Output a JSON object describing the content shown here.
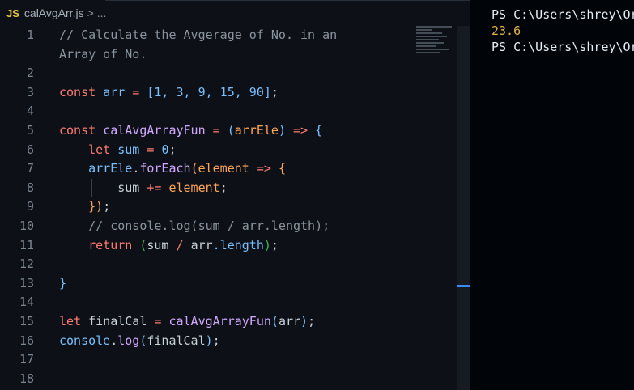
{
  "breadcrumb": {
    "language_badge": "JS",
    "file_name": "calAvgArr.js",
    "separator": ">",
    "more": "..."
  },
  "editor": {
    "line_numbers": [
      "1",
      "",
      "2",
      "3",
      "4",
      "5",
      "6",
      "7",
      "8",
      "9",
      "10",
      "11",
      "12",
      "13",
      "14",
      "15",
      "16",
      "17",
      "18"
    ],
    "code": {
      "l1a": "// Calculate the Avgerage of No. in an",
      "l1b": "Array of No.",
      "l3_kw": "const",
      "l3_var": "arr",
      "l3_eq": " = ",
      "l3_open": "[",
      "l3_vals": "1, 3, 9, 15, 90",
      "l3_close": "]",
      "l3_semi": ";",
      "l5_kw": "const",
      "l5_fn": "calAvgArrayFun",
      "l5_eq": " = ",
      "l5_po": "(",
      "l5_param": "arrEle",
      "l5_pc": ")",
      "l5_arrow": " => ",
      "l5_brace": "{",
      "l6_kw": "let",
      "l6_var": "sum",
      "l6_eq": " = ",
      "l6_num": "0",
      "l6_semi": ";",
      "l7_obj": "arrEle",
      "l7_dot": ".",
      "l7_fn": "forEach",
      "l7_po": "(",
      "l7_param": "element",
      "l7_arrow": " => ",
      "l7_brace": "{",
      "l8_var": "sum",
      "l8_op": " += ",
      "l8_param": "element",
      "l8_semi": ";",
      "l9_close": "}",
      "l9_pc": ")",
      "l9_semi": ";",
      "l10_comment": "// console.log(sum / arr.length);",
      "l11_kw": "return",
      "l11_po": "(",
      "l11_var": "sum",
      "l11_op": " / ",
      "l11_obj": "arr",
      "l11_prop": ".length",
      "l11_pc": ")",
      "l11_semi": ";",
      "l13_brace": "}",
      "l15_kw": "let",
      "l15_var": "finalCal",
      "l15_eq": " = ",
      "l15_fn": "calAvgArrayFun",
      "l15_po": "(",
      "l15_arg": "arr",
      "l15_pc": ")",
      "l15_semi": ";",
      "l16_obj": "console",
      "l16_dot": ".",
      "l16_fn": "log",
      "l16_po": "(",
      "l16_arg": "finalCal",
      "l16_pc": ")",
      "l16_semi": ";"
    }
  },
  "terminal": {
    "lines": [
      {
        "text": "PS C:\\Users\\shrey\\Or",
        "kind": "prompt"
      },
      {
        "text": "23.6",
        "kind": "output"
      },
      {
        "text": "PS C:\\Users\\shrey\\Or",
        "kind": "prompt"
      }
    ]
  },
  "colors": {
    "background": "#0d1117",
    "keyword": "#ff7b72",
    "variable": "#79c0ff",
    "function": "#d2a8ff",
    "parameter": "#ffa657",
    "comment": "#8b949e",
    "terminal_output": "#e3b341"
  }
}
